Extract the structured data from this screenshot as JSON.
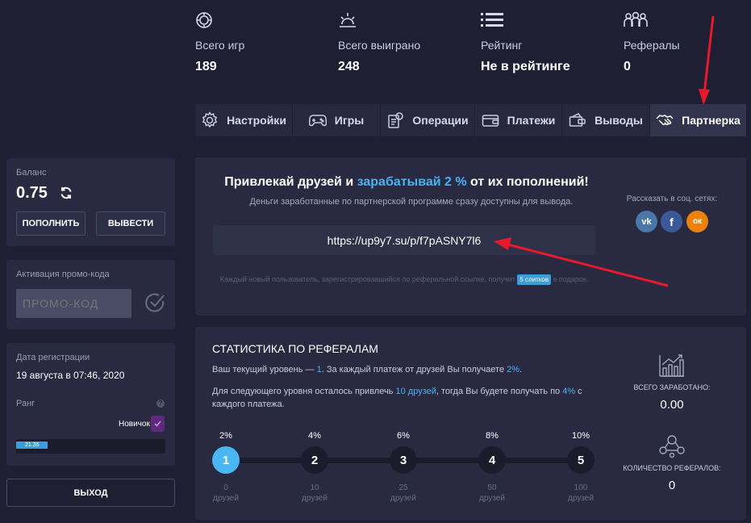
{
  "stats": [
    {
      "label": "Всего игр",
      "value": "189",
      "icon": "chip-icon"
    },
    {
      "label": "Всего выиграно",
      "value": "248",
      "icon": "sunrise-icon"
    },
    {
      "label": "Рейтинг",
      "value": "Не в рейтинге",
      "icon": "list-icon"
    },
    {
      "label": "Рефералы",
      "value": "0",
      "icon": "users-icon"
    }
  ],
  "tabs": [
    {
      "label": "Настройки",
      "icon": "gear-icon"
    },
    {
      "label": "Игры",
      "icon": "gamepad-icon"
    },
    {
      "label": "Операции",
      "icon": "receipt-icon"
    },
    {
      "label": "Платежи",
      "icon": "wallet-icon"
    },
    {
      "label": "Выводы",
      "icon": "money-icon"
    },
    {
      "label": "Партнерка",
      "icon": "handshake-icon",
      "active": true
    }
  ],
  "balance": {
    "label": "Баланс",
    "value": "0.75",
    "deposit_label": "ПОПОЛНИТЬ",
    "withdraw_label": "ВЫВЕСТИ"
  },
  "promo": {
    "label": "Активация промо-кода",
    "placeholder": "ПРОМО-КОД"
  },
  "profile": {
    "reg_label": "Дата регистрации",
    "reg_date": "19 августа в 07:46, 2020",
    "rank_label": "Ранг",
    "help": "?",
    "rank_name": "Новичок",
    "progress_value": "21.35",
    "progress_fraction": 0.2135
  },
  "logout_label": "ВЫХОД",
  "referral": {
    "title_part1": "Привлекай друзей и ",
    "title_highlight": "зарабатывай 2 %",
    "title_part2": " от их пополнений!",
    "subtitle": "Деньги заработанные по партнерской программе сразу доступны для вывода.",
    "link": "https://up9y7.su/p/f7pASNY7l6",
    "note_part1": "Каждый новый пользователь, зарегистрировавшийся по реферальной ссылке, получит ",
    "note_badge": "5 слитков",
    "note_part2": " в подарок.",
    "share_label": "Рассказать в соц. сетях:",
    "socials": [
      {
        "name": "vk",
        "glyph": "vk",
        "color": "#4a76a8"
      },
      {
        "name": "facebook",
        "glyph": "f",
        "color": "#3b5998"
      },
      {
        "name": "odnoklassniki",
        "glyph": "ок",
        "color": "#ee8208"
      }
    ]
  },
  "stats_panel": {
    "title": "СТАТИСТИКА ПО РЕФЕРАЛАМ",
    "line1_part1": "Ваш текущий уровень — ",
    "line1_level": "1",
    "line1_part2": ". За каждый платеж от друзей Вы получаете ",
    "line1_pct": "2%",
    "line1_part3": ".",
    "line2_part1": "Для следующего уровня осталось привлечь ",
    "line2_friends": "10 друзей",
    "line2_part2": ", тогда Вы будете получать по ",
    "line2_pct": "4%",
    "line2_part3": " с каждого платежа.",
    "levels": [
      {
        "pct": "2%",
        "num": "1",
        "count": "0",
        "unit": "друзей",
        "active": true
      },
      {
        "pct": "4%",
        "num": "2",
        "count": "10",
        "unit": "друзей"
      },
      {
        "pct": "6%",
        "num": "3",
        "count": "25",
        "unit": "друзей"
      },
      {
        "pct": "8%",
        "num": "4",
        "count": "50",
        "unit": "друзей"
      },
      {
        "pct": "10%",
        "num": "5",
        "count": "100",
        "unit": "друзей"
      }
    ],
    "earned_label": "ВСЕГО ЗАРАБОТАНО:",
    "earned_value": "0.00",
    "refcount_label": "КОЛИЧЕСТВО РЕФЕРАЛОВ:",
    "refcount_value": "0"
  },
  "colors": {
    "background": "#1e1f33",
    "panel": "#292a42",
    "accent": "#47b3f0",
    "arrow": "#e8192c",
    "rank_check": "#5e2a7a"
  }
}
